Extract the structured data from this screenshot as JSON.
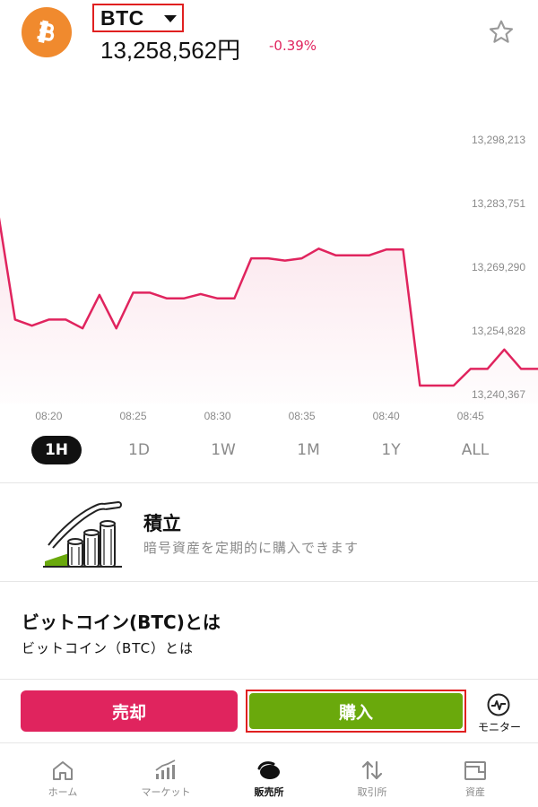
{
  "header": {
    "symbol": "BTC",
    "price": "13,258,562円",
    "change": "-0.39%",
    "colors": {
      "logo": "#f08a2e",
      "change": "#e0245e"
    }
  },
  "chart_data": {
    "type": "area",
    "x": [
      "08:17",
      "08:18",
      "08:19",
      "08:20",
      "08:21",
      "08:22",
      "08:23",
      "08:24",
      "08:25",
      "08:26",
      "08:27",
      "08:28",
      "08:29",
      "08:30",
      "08:31",
      "08:32",
      "08:33",
      "08:34",
      "08:35",
      "08:36",
      "08:37",
      "08:38",
      "08:39",
      "08:40",
      "08:41",
      "08:42",
      "08:43",
      "08:44",
      "08:45",
      "08:46",
      "08:47",
      "08:48",
      "08:49"
    ],
    "y": [
      13281600,
      13257400,
      13256000,
      13257400,
      13257400,
      13255400,
      13263000,
      13255400,
      13263500,
      13263500,
      13262200,
      13262200,
      13263200,
      13262200,
      13262200,
      13271300,
      13271300,
      13270800,
      13271300,
      13273500,
      13272000,
      13272000,
      13272000,
      13273300,
      13273300,
      13242400,
      13242400,
      13242400,
      13246200,
      13246200,
      13250600,
      13246200,
      13246200
    ],
    "x_ticks": [
      "08:20",
      "08:25",
      "08:30",
      "08:35",
      "08:40",
      "08:45"
    ],
    "y_ticks": [
      "13,298,213",
      "13,283,751",
      "13,269,290",
      "13,254,828",
      "13,240,367"
    ],
    "y_tick_values": [
      13298213,
      13283751,
      13269290,
      13254828,
      13240367
    ],
    "grid": false,
    "line_color": "#e0245e"
  },
  "periods": [
    "1H",
    "1D",
    "1W",
    "1M",
    "1Y",
    "ALL"
  ],
  "active_period": "1H",
  "tsumitate": {
    "title": "積立",
    "desc": "暗号資産を定期的に購入できます"
  },
  "about": {
    "title": "ビットコイン(BTC)とは",
    "text": "ビットコイン（BTC）とは"
  },
  "actions": {
    "sell": "売却",
    "buy": "購入",
    "monitor": "モニター",
    "colors": {
      "sell": "#e0245e",
      "buy": "#6aa90c"
    }
  },
  "tabs": [
    {
      "label": "ホーム",
      "icon": "home-icon"
    },
    {
      "label": "マーケット",
      "icon": "market-icon"
    },
    {
      "label": "販売所",
      "icon": "exchange-icon"
    },
    {
      "label": "取引所",
      "icon": "trade-icon"
    },
    {
      "label": "資産",
      "icon": "wallet-icon"
    }
  ],
  "active_tab": "販売所"
}
